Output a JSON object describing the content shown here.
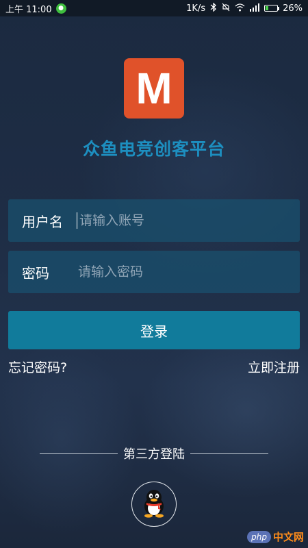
{
  "status_bar": {
    "time": "上午 11:00",
    "net_speed": "1K/s",
    "battery_percent": "26%",
    "battery_level": 0.26,
    "icons": [
      "wechat-icon",
      "bluetooth-icon",
      "mute-icon",
      "wifi-icon",
      "signal-icon",
      "battery-icon"
    ]
  },
  "logo": {
    "letter": "M",
    "color": "#e0522a"
  },
  "app": {
    "title": "众鱼电竞创客平台",
    "title_color": "#1d8fc0"
  },
  "form": {
    "username": {
      "label": "用户名",
      "placeholder": "请输入账号",
      "value": ""
    },
    "password": {
      "label": "密码",
      "placeholder": "请输入密码",
      "value": ""
    },
    "login_label": "登录",
    "login_color": "#117b9b"
  },
  "links": {
    "forgot": "忘记密码?",
    "register": "立即注册"
  },
  "third_party": {
    "title": "第三方登陆",
    "providers": [
      "qq-icon"
    ]
  },
  "watermark": {
    "badge": "php",
    "text": "中文网"
  }
}
